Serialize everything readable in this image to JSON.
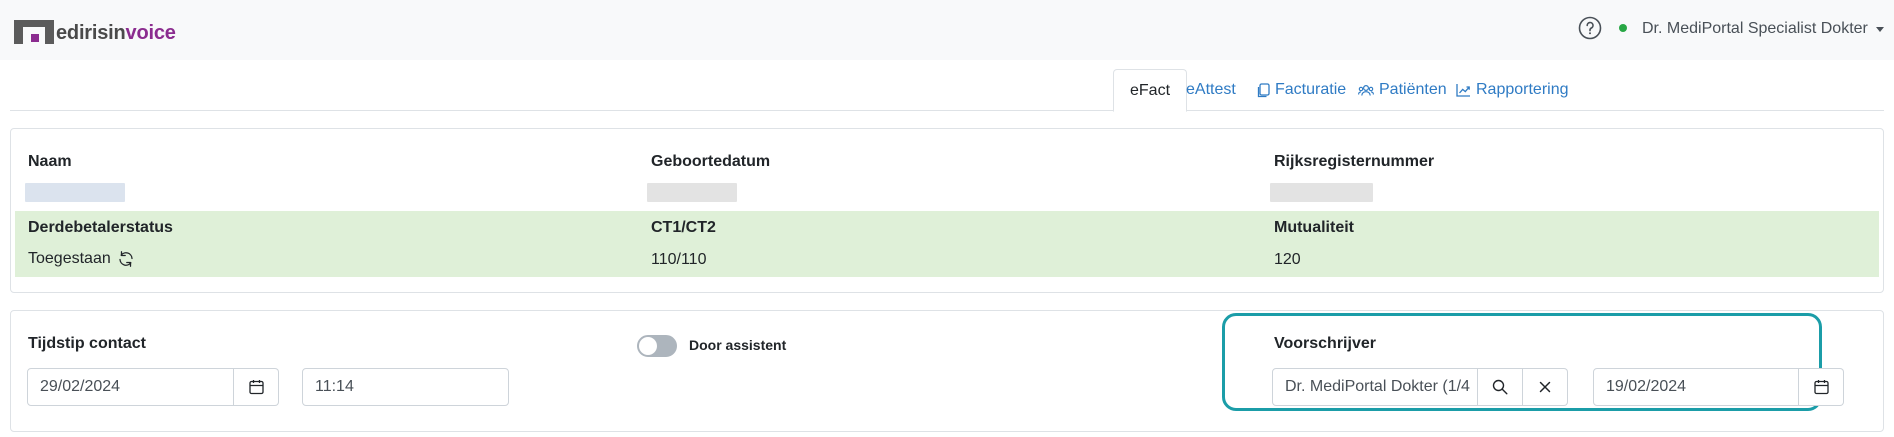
{
  "app": {
    "logo_part1": "edirisin",
    "logo_part2": "voice",
    "logo_prefix": "M",
    "user_name": "Dr. MediPortal Specialist Dokter",
    "status_color": "#28a745",
    "accent_color": "#2f7bc4"
  },
  "tabs": [
    {
      "label": "eFact",
      "icon": "",
      "active": true
    },
    {
      "label": "eAttest",
      "icon": "",
      "active": false
    },
    {
      "label": "Facturatie",
      "icon": "copy-icon",
      "active": false
    },
    {
      "label": "Patiënten",
      "icon": "users-icon",
      "active": false
    },
    {
      "label": "Rapportering",
      "icon": "chart-icon",
      "active": false
    }
  ],
  "patient": {
    "name_label": "Naam",
    "birth_label": "Geboortedatum",
    "rrn_label": "Rijksregisternummer",
    "third_party_label": "Derdebetalerstatus",
    "third_party_value": "Toegestaan",
    "ct_label": "CT1/CT2",
    "ct_value": "110/110",
    "mutuality_label": "Mutualiteit",
    "mutuality_value": "120"
  },
  "contact": {
    "time_label": "Tijdstip contact",
    "date_value": "29/02/2024",
    "time_value": "11:14",
    "assistant_label": "Door assistent",
    "assistant_on": false,
    "prescriber_label": "Voorschrijver",
    "prescriber_value": "Dr. MediPortal Dokter (1/4",
    "prescription_date": "19/02/2024"
  }
}
